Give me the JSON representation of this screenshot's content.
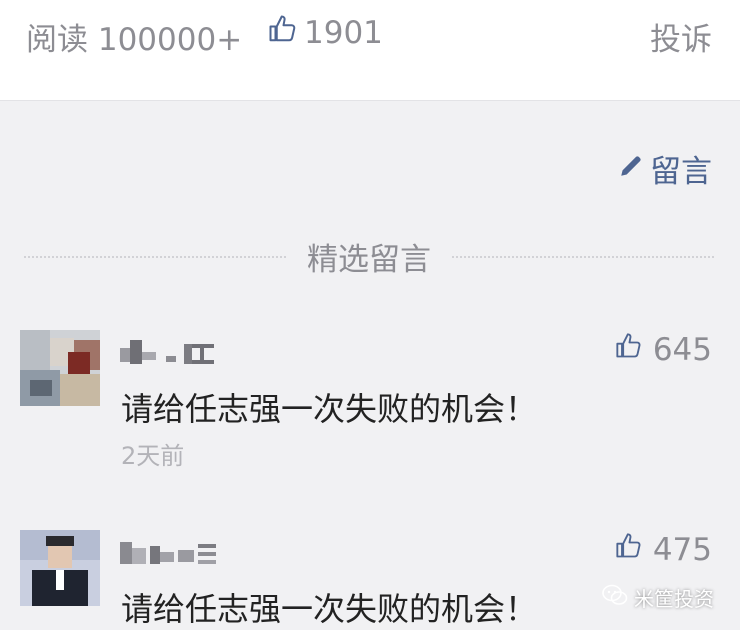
{
  "header": {
    "read_label": "阅读 100000+",
    "like_count": "1901",
    "report_label": "投诉"
  },
  "write_message": {
    "label": "留言",
    "icon": "pencil-icon"
  },
  "section": {
    "title": "精选留言"
  },
  "comments": [
    {
      "author": "",
      "text": "请给任志强一次失败的机会！",
      "time": "2天前",
      "likes": "645"
    },
    {
      "author": "",
      "text": "请给任志强一次失败的机会！",
      "time": "",
      "likes": "475"
    }
  ],
  "watermark": {
    "text": "米筐投资"
  },
  "colors": {
    "background": "#f1f1f3",
    "header_bg": "#ffffff",
    "link_blue": "#4e6591",
    "muted_gray": "#8d8d93",
    "text_dark": "#222222"
  }
}
